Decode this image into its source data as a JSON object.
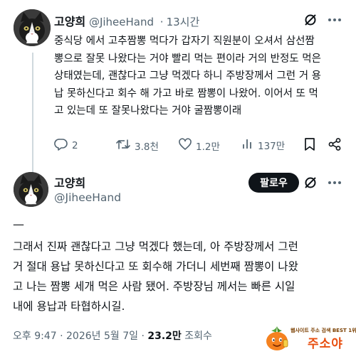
{
  "post1": {
    "name": "고양희",
    "handle": "@JiheeHand",
    "time": "13시간",
    "text": "중식당 에서 고추짬뽕 먹다가 갑자기 직원분이 오셔서 삼선짬\n뽕으로 잘못 나왔다는 거야 빨리 먹는 편이라 거의 반정도 먹은\n상태였는데, 괜찮다고 그냥 먹겠다 하니 주방장께서 그런 거 용\n납 못하신다고 회수 해 가고 바로 짬뽕이 나왔어. 이어서 또 먹\n고 있는데 또 잘못나왔다는 거야 굴짬뽕이래",
    "actions": {
      "replies": "2",
      "reposts": "3.8천",
      "likes": "1.2만",
      "views": "137만"
    }
  },
  "post2": {
    "name": "고양희",
    "handle": "@JiheeHand",
    "follow_label": "팔로우",
    "dash": "—",
    "text": "그래서 진짜 괜찮다고 그냥 먹겠다 했는데, 아 주방장께서 그런\n거 절대 용납 못하신다고 또 회수해 가더니 세번째 짬뽕이 나왔\n고 나는 짬뽕 세개 먹은 사람 됐어. 주방장님 께서는 빠른 시일\n내에 용납과 타협하시길.",
    "meta": {
      "time": "오후 9:47",
      "date": "2026년 5월 7일",
      "views_count": "23.2만",
      "views_label": "조회수",
      "sep": "·"
    }
  },
  "watermark": {
    "tagline": "웹사이트 주소 검색 BEST 1위",
    "brand": "주소야"
  },
  "colors": {
    "text": "#0f1419",
    "muted": "#536471",
    "thread_line": "#cfd9de",
    "follow_bg": "#0f1419",
    "watermark_orange": "#e84e0f"
  },
  "icons": [
    "grok-icon",
    "more-icon",
    "reply-icon",
    "repost-icon",
    "like-icon",
    "views-icon",
    "bookmark-icon",
    "share-icon"
  ]
}
